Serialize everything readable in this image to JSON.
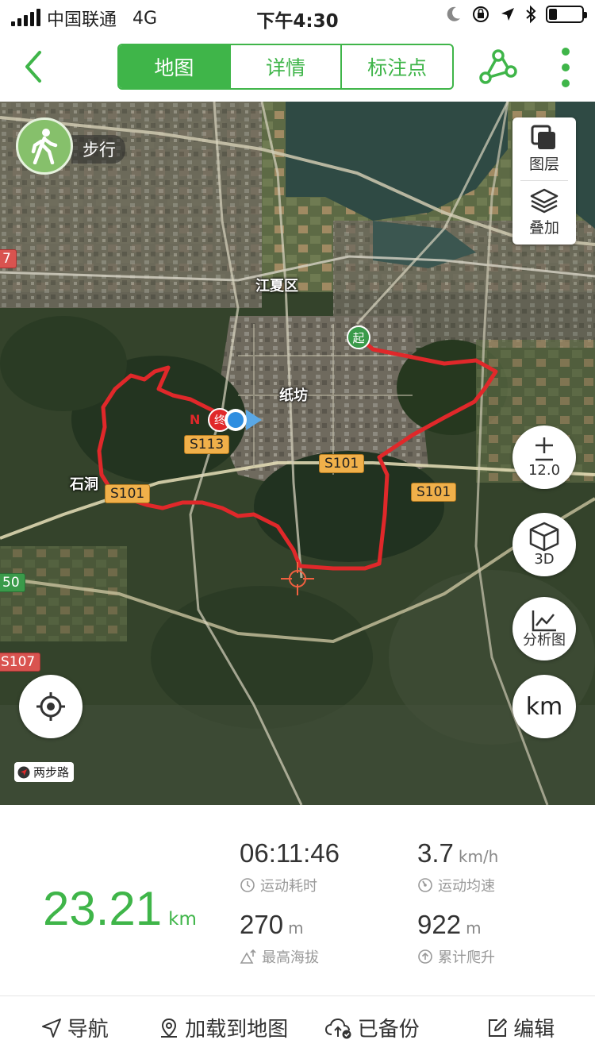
{
  "status_bar": {
    "carrier": "中国联通",
    "network": "4G",
    "time": "下午4:30",
    "battery_level": 0.25
  },
  "nav": {
    "tabs": [
      {
        "label": "地图",
        "active": true
      },
      {
        "label": "详情",
        "active": false
      },
      {
        "label": "标注点",
        "active": false
      }
    ],
    "accent_color": "#3fb549"
  },
  "map": {
    "mode_label": "步行",
    "layer_panel": {
      "layers_label": "图层",
      "overlay_label": "叠加"
    },
    "zoom_level": "12.0",
    "view_3d_label": "3D",
    "analysis_label": "分析图",
    "unit_label": "km",
    "provider_label": "两步路",
    "place_labels": [
      "江夏区",
      "纸坊",
      "石洞"
    ],
    "road_labels": [
      "S113",
      "S101",
      "S101",
      "S101"
    ],
    "edge_labels": [
      "7",
      "50",
      "S107"
    ],
    "start_marker": "起",
    "end_marker": "终",
    "track_color": "#e0282a"
  },
  "stats": {
    "distance": "23.21",
    "distance_unit": "km",
    "duration": "06:11:46",
    "duration_caption": "运动耗时",
    "avg_speed": "3.7",
    "avg_speed_unit": "km/h",
    "avg_speed_caption": "运动均速",
    "max_altitude": "270",
    "max_altitude_unit": "m",
    "max_altitude_caption": "最高海拔",
    "total_climb": "922",
    "total_climb_unit": "m",
    "total_climb_caption": "累计爬升"
  },
  "toolbar": {
    "navigate": "导航",
    "load_to_map": "加载到地图",
    "backed_up": "已备份",
    "edit": "编辑"
  }
}
